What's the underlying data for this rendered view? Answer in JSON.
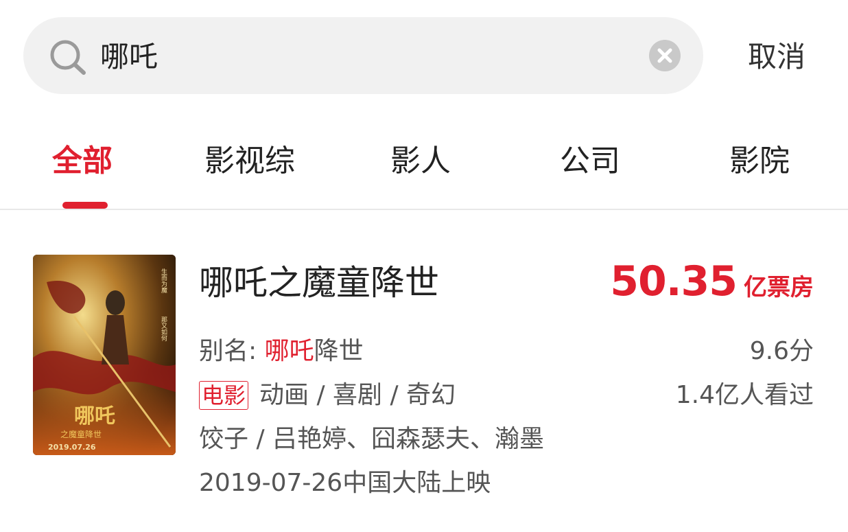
{
  "search": {
    "query": "哪吒",
    "cancel_label": "取消"
  },
  "tabs": [
    {
      "label": "全部",
      "active": true
    },
    {
      "label": "影视综",
      "active": false
    },
    {
      "label": "影人",
      "active": false
    },
    {
      "label": "公司",
      "active": false
    },
    {
      "label": "影院",
      "active": false
    }
  ],
  "result": {
    "title": "哪吒之魔童降世",
    "box_office_value": "50.35",
    "box_office_unit": "亿票房",
    "alias_label": "别名:",
    "alias_highlight": "哪吒",
    "alias_rest": "降世",
    "rating": "9.6分",
    "type_tag": "电影",
    "genres": "动画 / 喜剧 / 奇幻",
    "viewers": "1.4亿人看过",
    "cast": "饺子 / 吕艳婷、囧森瑟夫、瀚墨",
    "release": "2019-07-26中国大陆上映",
    "poster": {
      "title_art": "哪吒",
      "subtitle_art": "之魔童降世",
      "date_art": "2019.07.26",
      "tagline_art": "生而为魔 那又如何"
    }
  },
  "colors": {
    "accent": "#e0202f",
    "search_bg": "#f1f1f1",
    "divider": "#e8e8e8"
  }
}
